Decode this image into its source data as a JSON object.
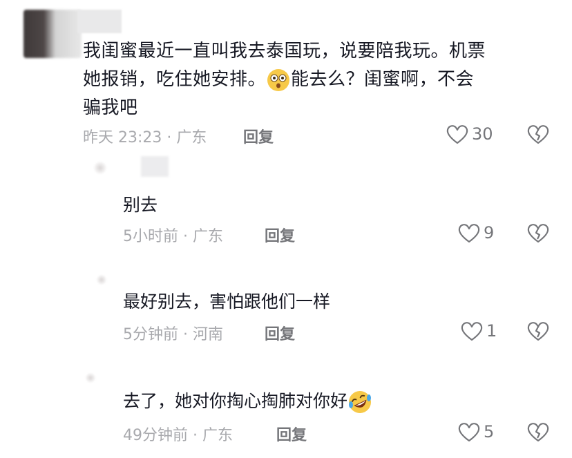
{
  "main_comment": {
    "line1": "我闺蜜最近一直叫我去泰国玩，说要陪我玩。机票",
    "line2a": "她报销，吃住她安排。",
    "line2_emoji": "flushed-face-emoji",
    "line2b": "能去么？闺蜜啊，不会",
    "line3": "骗我吧",
    "meta": "昨天 23:23 · 广东",
    "reply_label": "回复",
    "likes": "30"
  },
  "replies": [
    {
      "text": "别去",
      "meta": "5小时前 · 广东",
      "reply_label": "回复",
      "likes": "9"
    },
    {
      "text": "最好别去，害怕跟他们一样",
      "meta": "5分钟前 · 河南",
      "reply_label": "回复",
      "likes": "1"
    },
    {
      "text": "去了，她对你掏心掏肺对你好",
      "emoji": "rofl-emoji",
      "meta": "49分钟前 · 广东",
      "reply_label": "回复",
      "likes": "5"
    }
  ],
  "icons": {
    "like": "heart-outline-icon",
    "dislike": "broken-heart-icon"
  },
  "colors": {
    "text": "#161823",
    "meta": "#a8a9ad",
    "action": "#75767a"
  }
}
